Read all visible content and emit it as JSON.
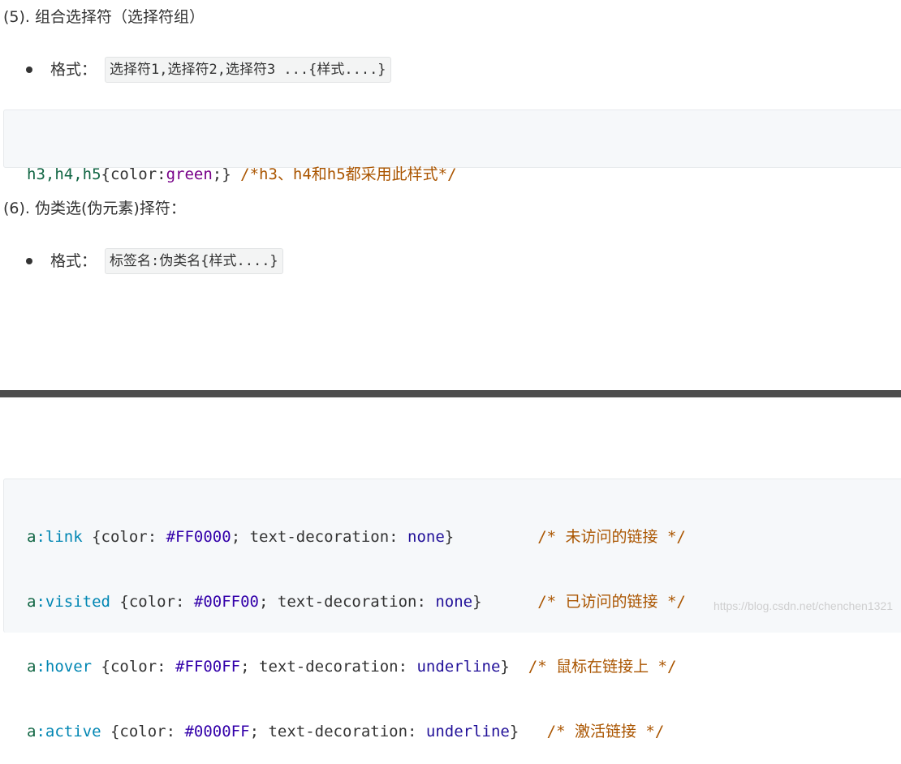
{
  "section5": {
    "heading": "(5). 组合选择符（选择符组）",
    "bullet_label": "格式：",
    "bullet_code": "选择符1,选择符2,选择符3 ...{样式....}",
    "code": {
      "selector": "h3,h4,h5",
      "open": "{color:",
      "value": "green",
      "close": ";}",
      "comment": "/*h3、h4和h5都采用此样式*/"
    }
  },
  "section6": {
    "heading": "(6). 伪类选(伪元素)择符：",
    "bullet_label": "格式：",
    "bullet_code": "标签名:伪类名{样式....}"
  },
  "code_block2": {
    "lines": [
      {
        "el": "a",
        "pseudo": ":link",
        "p1": " {color: ",
        "hex": "#FF0000",
        "p2": "; text-decoration: ",
        "kw": "none",
        "end": "}",
        "pad": "         ",
        "comment": "/* 未访问的链接 */"
      },
      {
        "el": "a",
        "pseudo": ":visited",
        "p1": " {color: ",
        "hex": "#00FF00",
        "p2": "; text-decoration: ",
        "kw": "none",
        "end": "}",
        "pad": "      ",
        "comment": "/* 已访问的链接 */"
      },
      {
        "el": "a",
        "pseudo": ":hover",
        "p1": " {color: ",
        "hex": "#FF00FF",
        "p2": "; text-decoration: ",
        "kw": "underline",
        "end": "}",
        "pad": "  ",
        "comment": "/* 鼠标在链接上 */"
      },
      {
        "el": "a",
        "pseudo": ":active",
        "p1": " {color: ",
        "hex": "#0000FF",
        "p2": "; text-decoration: ",
        "kw": "underline",
        "end": "}",
        "pad": "   ",
        "comment": "/* 激活链接 */"
      }
    ]
  },
  "watermark": "https://blog.csdn.net/chenchen1321",
  "colors": {
    "selector": "#116644",
    "value": "#770088",
    "comment": "#aa5500",
    "pseudo": "#0086b3",
    "hex": "#3300aa",
    "keyword": "#221199",
    "divider": "#4d4d4d"
  }
}
